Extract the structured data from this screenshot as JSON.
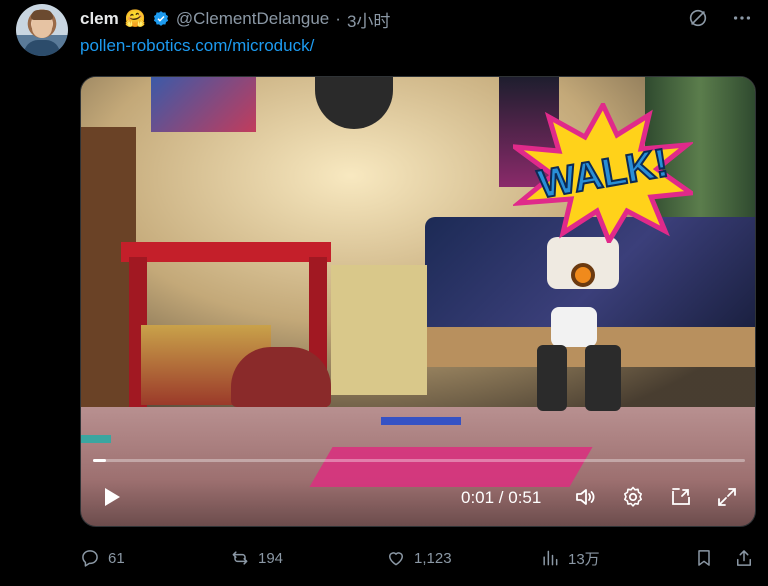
{
  "tweet": {
    "author_name": "clem",
    "author_emoji": "🤗",
    "handle": "@ClementDelangue",
    "separator": "·",
    "time": "3小时",
    "link_text": "pollen-robotics.com/microduck/"
  },
  "media": {
    "overlay_text": "WALK!",
    "timecode": "0:01 / 0:51",
    "progress_fraction": 0.02
  },
  "stats": {
    "replies": "61",
    "reposts": "194",
    "likes": "1,123",
    "views": "13万"
  },
  "colors": {
    "accent": "#1d9bf0",
    "muted": "#8b98a5",
    "background": "#000000"
  },
  "icons": {
    "verified": "verified-badge-icon",
    "grok": "grok-icon",
    "more": "more-icon",
    "play": "play-icon",
    "volume": "volume-icon",
    "settings": "gear-icon",
    "share_media": "pip-icon",
    "fullscreen": "fullscreen-icon",
    "reply": "reply-icon",
    "repost": "repost-icon",
    "like": "heart-icon",
    "views": "views-icon",
    "bookmark": "bookmark-icon",
    "share": "share-icon"
  }
}
